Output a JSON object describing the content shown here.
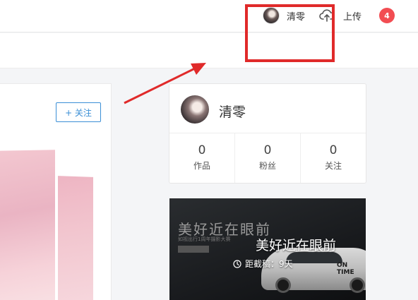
{
  "nav": {
    "username": "清零",
    "upload_label": "上传",
    "notification_count": "4"
  },
  "author": {
    "follow_label": "+ 关注"
  },
  "profile": {
    "name": "清零",
    "stats": [
      {
        "value": "0",
        "label": "作品"
      },
      {
        "value": "0",
        "label": "粉丝"
      },
      {
        "value": "0",
        "label": "关注"
      }
    ]
  },
  "banner": {
    "background_text": "美好近在眼前",
    "background_subtext": "如视出行1周年摄影大赛",
    "logo_text": "ON TIME",
    "title": "美好近在眼前",
    "deadline": "距截稿：9天"
  },
  "colors": {
    "accent": "#3b8fd6",
    "badge": "#f24d52",
    "annotation": "#e02a2a"
  },
  "icons": {
    "upload": "cloud-upload-icon",
    "clock": "clock-icon"
  }
}
